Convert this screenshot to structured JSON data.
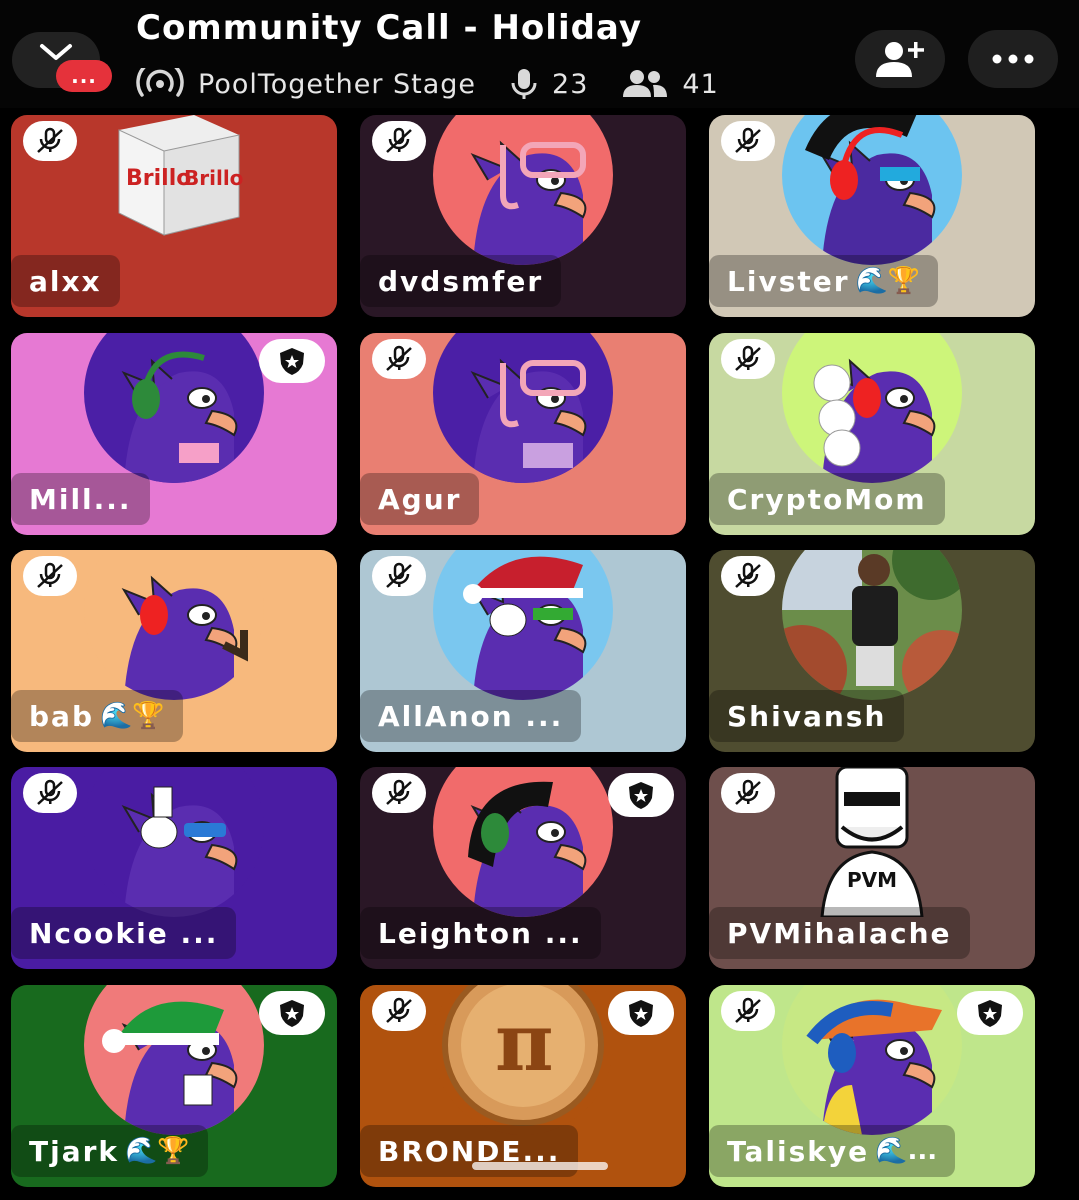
{
  "header": {
    "title": "Community Call - Holiday",
    "stage_name": "PoolTogether Stage",
    "speakers_count": "23",
    "listeners_count": "41",
    "live_label": "..."
  },
  "colors": {
    "header_bg": "#050505",
    "live_red": "#e5323b"
  },
  "participants": [
    {
      "name": "alxx",
      "suffix": "",
      "bg": "#b8372b",
      "avatar": "brillo-box",
      "muted": true,
      "moderator": false
    },
    {
      "name": "dvdsmfer",
      "suffix": "",
      "bg": "#2a1726",
      "avatar": "bird-snorkel",
      "muted": true,
      "moderator": false
    },
    {
      "name": "Livster",
      "suffix": "🌊🏆",
      "bg": "#d1c8b6",
      "avatar": "bird-headphones-blue",
      "muted": true,
      "moderator": false
    },
    {
      "name": "Mill...",
      "suffix": "",
      "bg": "#e679d3",
      "avatar": "bird-green-headphones",
      "muted": false,
      "moderator": true
    },
    {
      "name": "Agur",
      "suffix": "",
      "bg": "#e97f72",
      "avatar": "bird-snorkel-purple",
      "muted": true,
      "moderator": false
    },
    {
      "name": "CryptoMom",
      "suffix": "",
      "bg": "#c7d9a1",
      "avatar": "bird-wig",
      "muted": true,
      "moderator": false
    },
    {
      "name": "bab",
      "suffix": "🌊🏆",
      "bg": "#f7b97d",
      "avatar": "bird-pipe",
      "muted": true,
      "moderator": false
    },
    {
      "name": "AllAnon ...",
      "suffix": "",
      "bg": "#aec7d3",
      "avatar": "bird-santa-hat",
      "muted": true,
      "moderator": false
    },
    {
      "name": "Shivansh",
      "suffix": "",
      "bg": "#4f4d30",
      "avatar": "photo-person",
      "muted": true,
      "moderator": false
    },
    {
      "name": "Ncookie ...",
      "suffix": "",
      "bg": "#4a1ca3",
      "avatar": "bird-bandage",
      "muted": true,
      "moderator": false
    },
    {
      "name": "Leighton ...",
      "suffix": "",
      "bg": "#2a1726",
      "avatar": "bird-dark-hair",
      "muted": true,
      "moderator": true
    },
    {
      "name": "PVMihalache",
      "suffix": "",
      "bg": "#6e4f4c",
      "avatar": "sketch-figure",
      "muted": true,
      "moderator": false
    },
    {
      "name": "Tjark",
      "suffix": "🌊🏆",
      "bg": "#186a1e",
      "avatar": "bird-elf-hat",
      "muted": false,
      "moderator": true
    },
    {
      "name": "BRONDE...",
      "suffix": "",
      "bg": "#b0520e",
      "avatar": "pie",
      "muted": true,
      "moderator": true
    },
    {
      "name": "Taliskye",
      "suffix": "🌊...",
      "bg": "#bfe68b",
      "avatar": "bird-cap",
      "muted": true,
      "moderator": true
    }
  ]
}
